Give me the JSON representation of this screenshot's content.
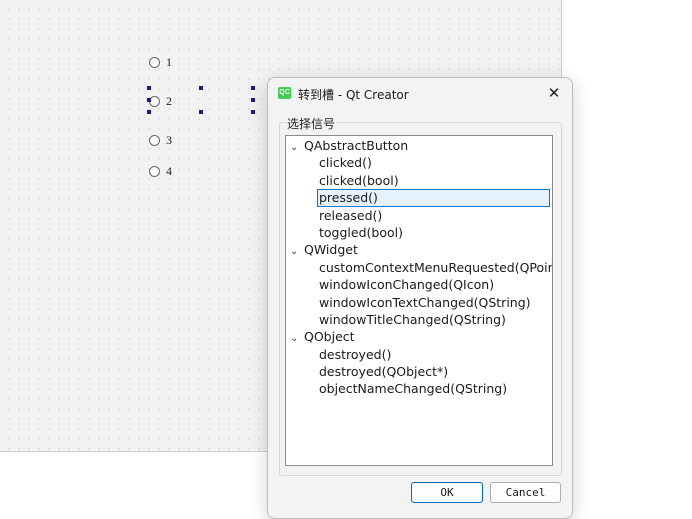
{
  "canvas": {
    "radio_buttons": [
      {
        "label": "1"
      },
      {
        "label": "2"
      },
      {
        "label": "3"
      },
      {
        "label": "4"
      }
    ]
  },
  "dialog": {
    "title": "转到槽 - Qt Creator",
    "app_icon_text": "QC",
    "close_glyph": "✕",
    "group_label": "选择信号",
    "tree": [
      {
        "label": "QAbstractButton",
        "children": [
          "clicked()",
          "clicked(bool)",
          "pressed()",
          "released()",
          "toggled(bool)"
        ]
      },
      {
        "label": "QWidget",
        "children": [
          "customContextMenuRequested(QPoint)",
          "windowIconChanged(QIcon)",
          "windowIconTextChanged(QString)",
          "windowTitleChanged(QString)"
        ]
      },
      {
        "label": "QObject",
        "children": [
          "destroyed()",
          "destroyed(QObject*)",
          "objectNameChanged(QString)"
        ]
      }
    ],
    "selected_item": "pressed()",
    "buttons": {
      "ok": "OK",
      "cancel": "Cancel"
    }
  },
  "colors": {
    "selection_border": "#0078d4",
    "selection_fill": "#e5f1fb",
    "handle": "#1a1a8c",
    "qt_green": "#41cd52"
  }
}
